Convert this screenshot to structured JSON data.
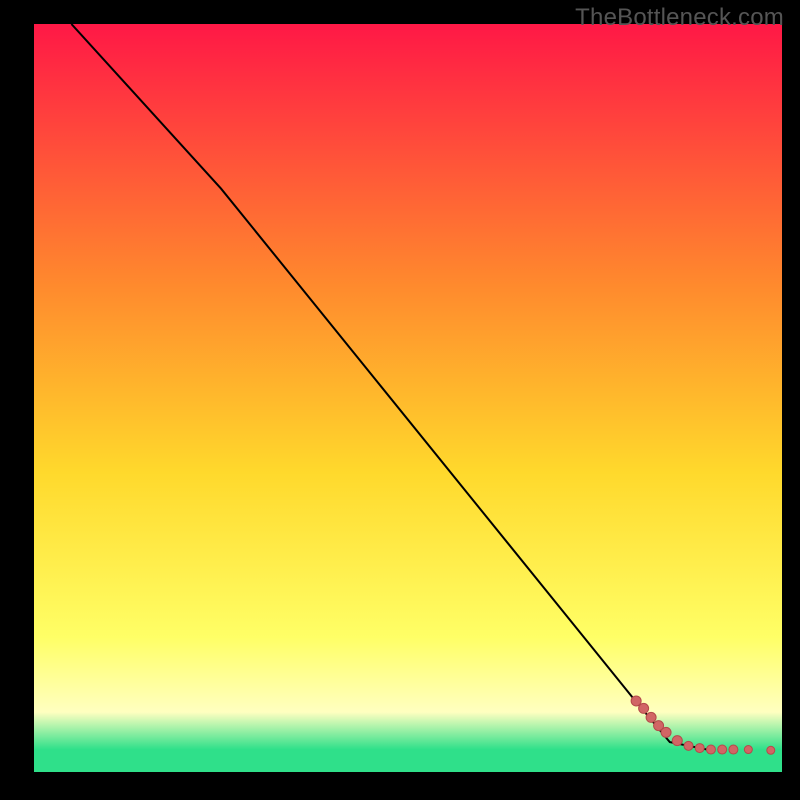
{
  "watermark": "TheBottleneck.com",
  "colors": {
    "frame": "#000000",
    "watermark_text": "#555555",
    "line": "#000000",
    "dot_fill": "#d16565",
    "dot_stroke": "#b44a4a",
    "gradient_top": "#ff1846",
    "gradient_upper_mid": "#ff8a2d",
    "gradient_mid": "#ffd92c",
    "gradient_lower_mid": "#ffff66",
    "gradient_pale": "#ffffc0",
    "gradient_bottom": "#2fe08a"
  },
  "chart_data": {
    "type": "line",
    "title": "",
    "xlabel": "",
    "ylabel": "",
    "xlim": [
      0,
      100
    ],
    "ylim": [
      0,
      100
    ],
    "series": [
      {
        "name": "curve",
        "points": [
          {
            "x": 5,
            "y": 100
          },
          {
            "x": 25,
            "y": 78
          },
          {
            "x": 80,
            "y": 10
          },
          {
            "x": 85,
            "y": 4
          },
          {
            "x": 90,
            "y": 3
          }
        ]
      }
    ],
    "markers": {
      "name": "dots",
      "points": [
        {
          "x": 80.5,
          "y": 9.5,
          "r": 5
        },
        {
          "x": 81.5,
          "y": 8.5,
          "r": 5
        },
        {
          "x": 82.5,
          "y": 7.3,
          "r": 5
        },
        {
          "x": 83.5,
          "y": 6.2,
          "r": 5
        },
        {
          "x": 84.5,
          "y": 5.3,
          "r": 5
        },
        {
          "x": 86.0,
          "y": 4.2,
          "r": 5
        },
        {
          "x": 87.5,
          "y": 3.5,
          "r": 4.5
        },
        {
          "x": 89.0,
          "y": 3.2,
          "r": 4.5
        },
        {
          "x": 90.5,
          "y": 3.0,
          "r": 4.5
        },
        {
          "x": 92.0,
          "y": 3.0,
          "r": 4.5
        },
        {
          "x": 93.5,
          "y": 3.0,
          "r": 4.5
        },
        {
          "x": 95.5,
          "y": 3.0,
          "r": 4
        },
        {
          "x": 98.5,
          "y": 2.9,
          "r": 4
        }
      ]
    },
    "gradient_stops": [
      {
        "offset": 0,
        "key": "gradient_top"
      },
      {
        "offset": 0.35,
        "key": "gradient_upper_mid"
      },
      {
        "offset": 0.6,
        "key": "gradient_mid"
      },
      {
        "offset": 0.82,
        "key": "gradient_lower_mid"
      },
      {
        "offset": 0.92,
        "key": "gradient_pale"
      },
      {
        "offset": 0.97,
        "key": "gradient_bottom"
      },
      {
        "offset": 1.0,
        "key": "gradient_bottom"
      }
    ]
  }
}
